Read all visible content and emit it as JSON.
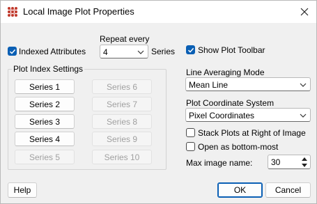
{
  "window": {
    "title": "Local Image Plot Properties"
  },
  "indexed_attributes": {
    "label": "Indexed Attributes",
    "checked": true
  },
  "repeat": {
    "label": "Repeat every",
    "value": "4",
    "suffix": "Series"
  },
  "plot_index": {
    "title": "Plot Index Settings",
    "series": [
      {
        "label": "Series 1",
        "enabled": true
      },
      {
        "label": "Series 2",
        "enabled": true
      },
      {
        "label": "Series 3",
        "enabled": true
      },
      {
        "label": "Series 4",
        "enabled": true
      },
      {
        "label": "Series 5",
        "enabled": false
      },
      {
        "label": "Series 6",
        "enabled": false
      },
      {
        "label": "Series 7",
        "enabled": false
      },
      {
        "label": "Series 8",
        "enabled": false
      },
      {
        "label": "Series 9",
        "enabled": false
      },
      {
        "label": "Series 10",
        "enabled": false
      }
    ]
  },
  "show_toolbar": {
    "label": "Show Plot Toolbar",
    "checked": true
  },
  "line_averaging": {
    "label": "Line Averaging Mode",
    "value": "Mean Line"
  },
  "coord_system": {
    "label": "Plot Coordinate System",
    "value": "Pixel Coordinates"
  },
  "stack_plots": {
    "label": "Stack Plots at Right of Image",
    "checked": false
  },
  "bottom_most": {
    "label": "Open as bottom-most",
    "checked": false
  },
  "max_name": {
    "label": "Max image name:",
    "value": "30"
  },
  "buttons": {
    "help": "Help",
    "ok": "OK",
    "cancel": "Cancel"
  },
  "colors": {
    "accent": "#0a5fb4",
    "icon": "#c0392b"
  }
}
